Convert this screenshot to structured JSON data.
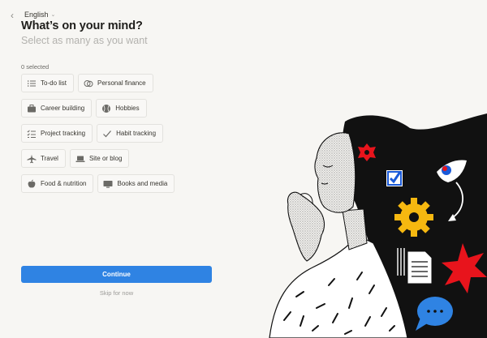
{
  "header": {
    "back_glyph": "‹",
    "language": "English",
    "title": "What’s on your mind?",
    "subtitle": "Select as many as you want"
  },
  "selection": {
    "count_label": "0 selected"
  },
  "options": [
    [
      {
        "label": "To-do list",
        "icon": "list-icon"
      },
      {
        "label": "Personal finance",
        "icon": "coins-icon"
      }
    ],
    [
      {
        "label": "Career building",
        "icon": "briefcase-icon"
      },
      {
        "label": "Hobbies",
        "icon": "baseball-icon"
      }
    ],
    [
      {
        "label": "Project tracking",
        "icon": "checklist-icon"
      },
      {
        "label": "Habit tracking",
        "icon": "checkmark-icon"
      }
    ],
    [
      {
        "label": "Travel",
        "icon": "airplane-icon"
      },
      {
        "label": "Site or blog",
        "icon": "laptop-icon"
      }
    ],
    [
      {
        "label": "Food & nutrition",
        "icon": "apple-icon"
      },
      {
        "label": "Books and media",
        "icon": "monitor-icon"
      }
    ]
  ],
  "actions": {
    "continue_label": "Continue",
    "skip_label": "Skip for now"
  },
  "colors": {
    "primary": "#2f83e3",
    "background": "#f7f6f3",
    "chip_border": "#e3e2de"
  }
}
